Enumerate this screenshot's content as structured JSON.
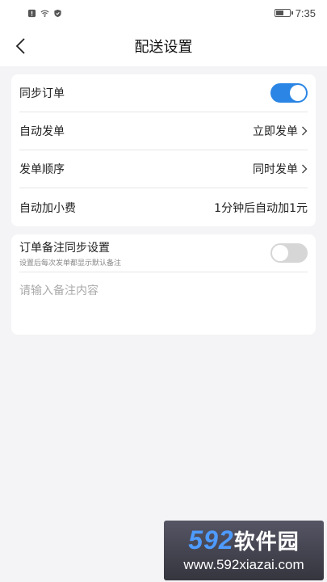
{
  "status_bar": {
    "time": "7:35",
    "battery_level": 0.6
  },
  "nav": {
    "title": "配送设置"
  },
  "settings": {
    "sync_orders": {
      "label": "同步订单",
      "enabled": true
    },
    "auto_dispatch": {
      "label": "自动发单",
      "value": "立即发单"
    },
    "dispatch_order": {
      "label": "发单顺序",
      "value": "同时发单"
    },
    "auto_tip": {
      "label": "自动加小费",
      "value": "1分钟后自动加1元"
    }
  },
  "remark": {
    "title": "订单备注同步设置",
    "subtitle": "设置后每次发单都显示默认备注",
    "enabled": false,
    "placeholder": "请输入备注内容"
  },
  "watermark": {
    "logo_num": "592",
    "logo_cn": "软件园",
    "url": "www.592xiazai.com"
  },
  "colors": {
    "accent": "#2a85e4",
    "toggle_off": "#d6d6d6",
    "background": "#f4f4f6"
  }
}
